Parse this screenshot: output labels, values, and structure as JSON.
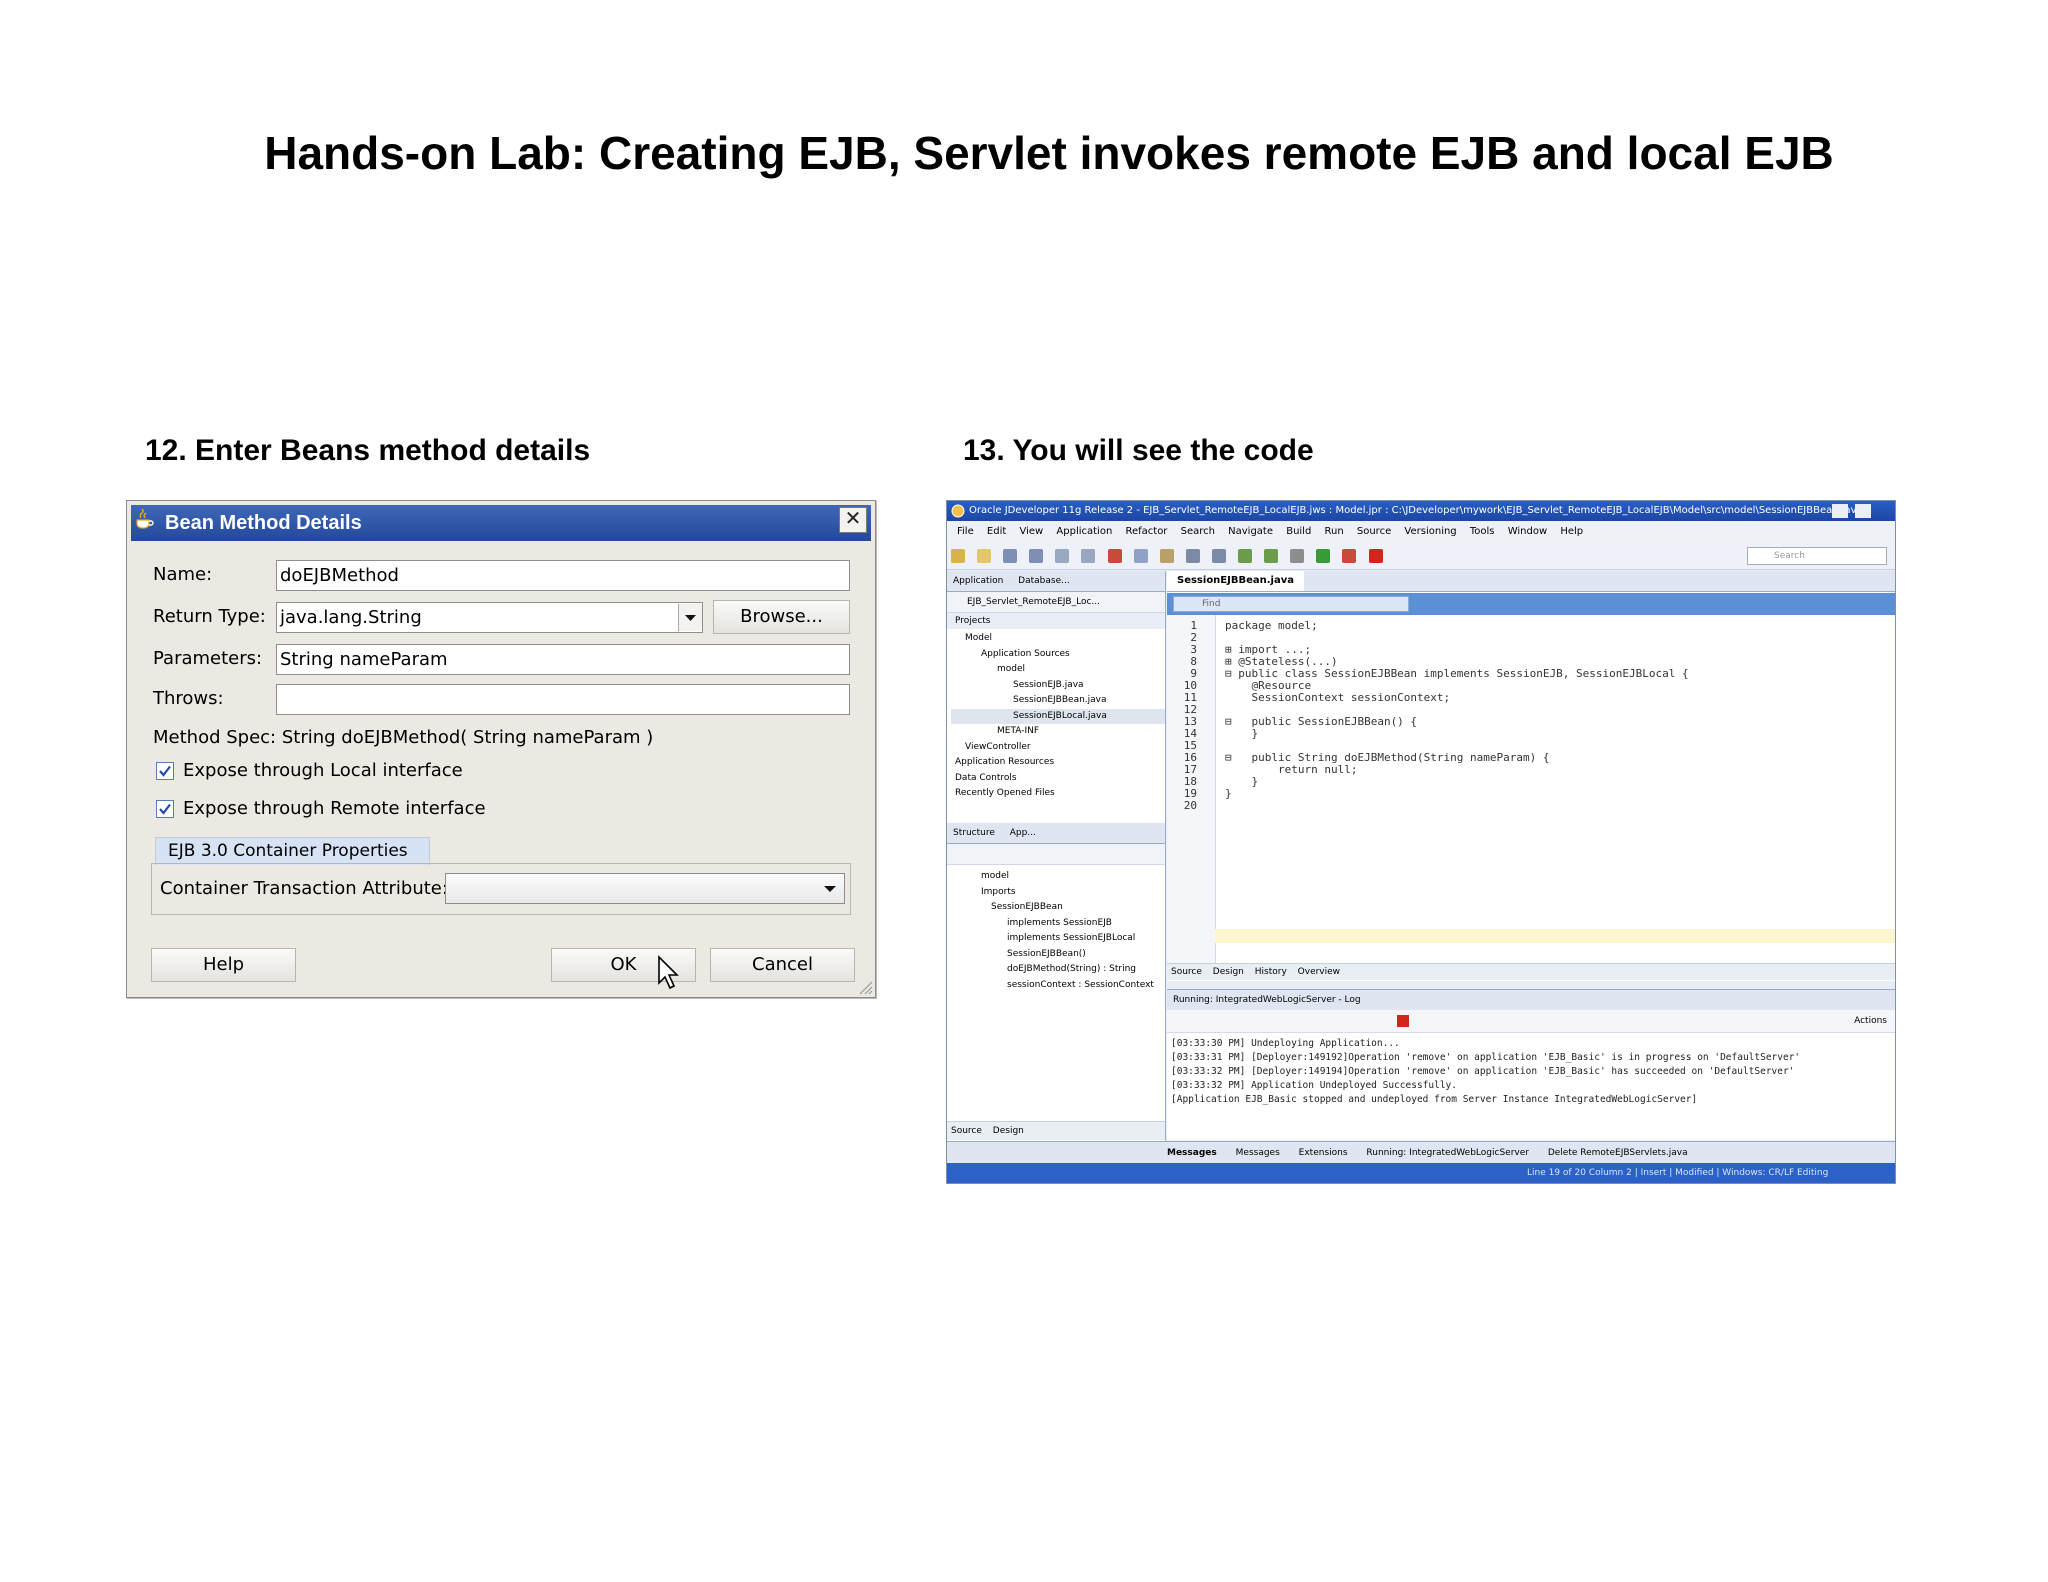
{
  "page": {
    "title": "Hands-on Lab: Creating EJB, Servlet invokes remote EJB and local EJB",
    "step12": "12. Enter Beans method details",
    "step13": "13. You will see the code"
  },
  "dialog": {
    "title": "Bean Method Details",
    "name_label": "Name:",
    "name_value": "doEJBMethod",
    "return_type_label": "Return Type:",
    "return_type_value": "java.lang.String",
    "browse_label": "Browse...",
    "parameters_label": "Parameters:",
    "parameters_value": "String nameParam",
    "throws_label": "Throws:",
    "throws_value": "",
    "method_spec": "Method Spec: String doEJBMethod( String nameParam )",
    "expose_local": "Expose through Local interface",
    "expose_remote": "Expose through Remote interface",
    "container_tab": "EJB 3.0 Container Properties",
    "transaction_label": "Container Transaction Attribute:",
    "transaction_value": "",
    "help_label": "Help",
    "ok_label": "OK",
    "cancel_label": "Cancel"
  },
  "ide": {
    "title": "Oracle JDeveloper 11g Release 2 - EJB_Servlet_RemoteEJB_LocalEJB.jws : Model.jpr : C:\\JDeveloper\\mywork\\EJB_Servlet_RemoteEJB_LocalEJB\\Model\\src\\model\\SessionEJBBean.java",
    "menus": [
      "File",
      "Edit",
      "View",
      "Application",
      "Refactor",
      "Search",
      "Navigate",
      "Build",
      "Run",
      "Source",
      "Versioning",
      "Tools",
      "Window",
      "Help"
    ],
    "search_placeholder": "Search",
    "app_tabs": [
      "Application",
      "Database..."
    ],
    "app_selector": "EJB_Servlet_RemoteEJB_Loc...",
    "projects_header": "Projects",
    "project_tree": [
      "Model",
      "Application Sources",
      "model",
      "SessionEJB.java",
      "SessionEJBBean.java",
      "SessionEJBLocal.java",
      "META-INF",
      "ViewController",
      "Application Resources",
      "Data Controls",
      "Recently Opened Files"
    ],
    "structure_tabs": [
      "Structure",
      "App..."
    ],
    "structure_tree": [
      "model",
      "Imports",
      "SessionEJBBean",
      "implements SessionEJB",
      "implements SessionEJBLocal",
      "SessionEJBBean()",
      "doEJBMethod(String) : String",
      "sessionContext : SessionContext"
    ],
    "editor_tab": "SessionEJBBean.java",
    "find_placeholder": "Find",
    "code_lines": [
      {
        "n": "1",
        "t": "package model;"
      },
      {
        "n": "2",
        "t": ""
      },
      {
        "n": "3",
        "t": "⊞ import ...;"
      },
      {
        "n": "8",
        "t": "⊞ @Stateless(...)"
      },
      {
        "n": "9",
        "t": "⊟ public class SessionEJBBean implements SessionEJB, SessionEJBLocal {"
      },
      {
        "n": "10",
        "t": "    @Resource"
      },
      {
        "n": "11",
        "t": "    SessionContext sessionContext;"
      },
      {
        "n": "12",
        "t": ""
      },
      {
        "n": "13",
        "t": "⊟   public SessionEJBBean() {"
      },
      {
        "n": "14",
        "t": "    }"
      },
      {
        "n": "15",
        "t": ""
      },
      {
        "n": "16",
        "t": "⊟   public String doEJBMethod(String nameParam) {"
      },
      {
        "n": "17",
        "t": "        return null;"
      },
      {
        "n": "18",
        "t": "    }"
      },
      {
        "n": "19",
        "t": "}"
      },
      {
        "n": "20",
        "t": ""
      }
    ],
    "editor_bottom_tabs": [
      "Source",
      "Design",
      "History",
      "Overview"
    ],
    "log_tab": "Running: IntegratedWebLogicServer - Log",
    "actions_label": "Actions",
    "log_lines": [
      "[03:33:30 PM] Undeploying Application...",
      "[03:33:31 PM] [Deployer:149192]Operation 'remove' on application 'EJB_Basic' is in progress on 'DefaultServer'",
      "[03:33:32 PM] [Deployer:149194]Operation 'remove' on application 'EJB_Basic' has succeeded on 'DefaultServer'",
      "[03:33:32 PM] Application Undeployed Successfully.",
      "[Application EJB_Basic stopped and undeployed from Server Instance IntegratedWebLogicServer]"
    ],
    "left_bottom_tabs": [
      "Source",
      "Design"
    ],
    "bottom_tabs": [
      "Messages",
      "Messages",
      "Extensions",
      "Running: IntegratedWebLogicServer",
      "Delete RemoteEJBServlets.java"
    ],
    "status": "Line 19 of 20 Column 2  |  Insert  |  Modified  |  Windows: CR/LF  Editing"
  }
}
